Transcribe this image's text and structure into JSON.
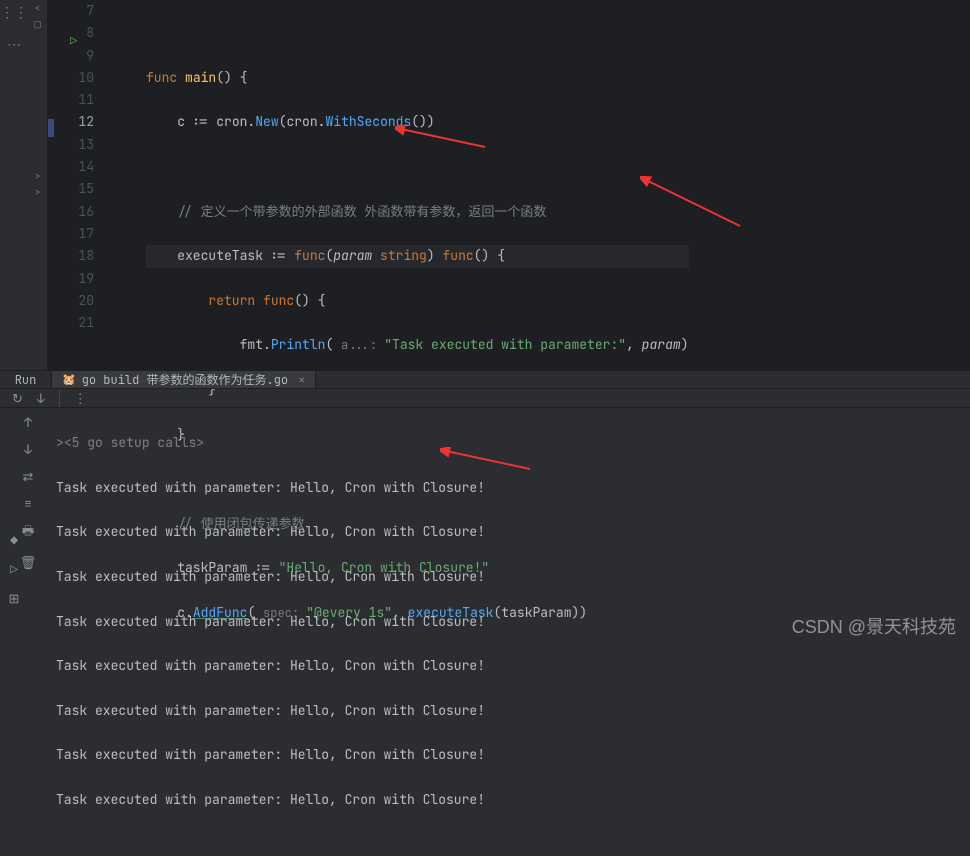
{
  "editor": {
    "lineNumbers": [
      "7",
      "8",
      "9",
      "10",
      "11",
      "12",
      "13",
      "14",
      "15",
      "16",
      "17",
      "18",
      "19",
      "20",
      "21"
    ],
    "currentLine": "12",
    "code": {
      "l8": {
        "kw1": "func ",
        "name": "main",
        "rest": "() {"
      },
      "l9": {
        "id": "c",
        "assign": " := ",
        "pkg": "cron",
        "dot1": ".",
        "new": "New",
        "par1": "(",
        "pkg2": "cron",
        "dot2": ".",
        "ws": "WithSeconds",
        "par2": "())"
      },
      "l11": "// 定义一个带参数的外部函数 外函数带有参数，返回一个函数",
      "l12": {
        "id": "executeTask",
        "assign": " := ",
        "kw": "func",
        "open": "(",
        "param": "param ",
        "type": "string",
        "close": ") ",
        "kw2": "func",
        "rest": "() {"
      },
      "l13": {
        "kw": "return ",
        "kw2": "func",
        "rest": "() {"
      },
      "l14": {
        "pkg": "fmt",
        "dot": ".",
        "fn": "Println",
        "open": "( ",
        "hint": "a...: ",
        "str": "\"Task executed with parameter:\"",
        "comma": ", ",
        "param": "param",
        "close": ")"
      },
      "l15": "}",
      "l16": "}",
      "l18": "// 使用闭包传递参数",
      "l19": {
        "id": "taskParam",
        "assign": " := ",
        "str": "\"Hello, Cron with Closure!\""
      },
      "l20": {
        "id": "c",
        "dot": ".",
        "fn": "AddFunc",
        "open": "( ",
        "hint": "spec: ",
        "str": "\"@every 1s\"",
        "comma": ", ",
        "id2": "executeTask",
        "open2": "(",
        "id3": "taskParam",
        "close": "))"
      }
    }
  },
  "toolWindow": {
    "runLabel": "Run",
    "tabLabel": "go build 带参数的函数作为任务.go",
    "tabGoIcon": "🐹",
    "tabClose": "×",
    "toolbar": {
      "rerun": "↻",
      "stop": "↓",
      "more": "⋮"
    },
    "gutterIcons": {
      "up": "↑",
      "down": "↓",
      "wrap": "⇄",
      "filter": "≡",
      "print": "🖶",
      "trash": "🗑"
    }
  },
  "console": {
    "fold": "><5 go setup calls>",
    "lines": [
      "Task executed with parameter: Hello, Cron with Closure!",
      "Task executed with parameter: Hello, Cron with Closure!",
      "Task executed with parameter: Hello, Cron with Closure!",
      "Task executed with parameter: Hello, Cron with Closure!",
      "Task executed with parameter: Hello, Cron with Closure!",
      "Task executed with parameter: Hello, Cron with Closure!",
      "Task executed with parameter: Hello, Cron with Closure!",
      "Task executed with parameter: Hello, Cron with Closure!"
    ]
  },
  "leftRail": {
    "i1": "⋮⋮",
    "i2": "⋯"
  },
  "projectStrip": {
    "collapse": "<",
    "box": "▢",
    "arr1": ">",
    "arr2": ">"
  },
  "bottomRail": {
    "i1": "◆",
    "i2": "▷",
    "i3": "⊞"
  },
  "watermark": "CSDN @景天科技苑"
}
